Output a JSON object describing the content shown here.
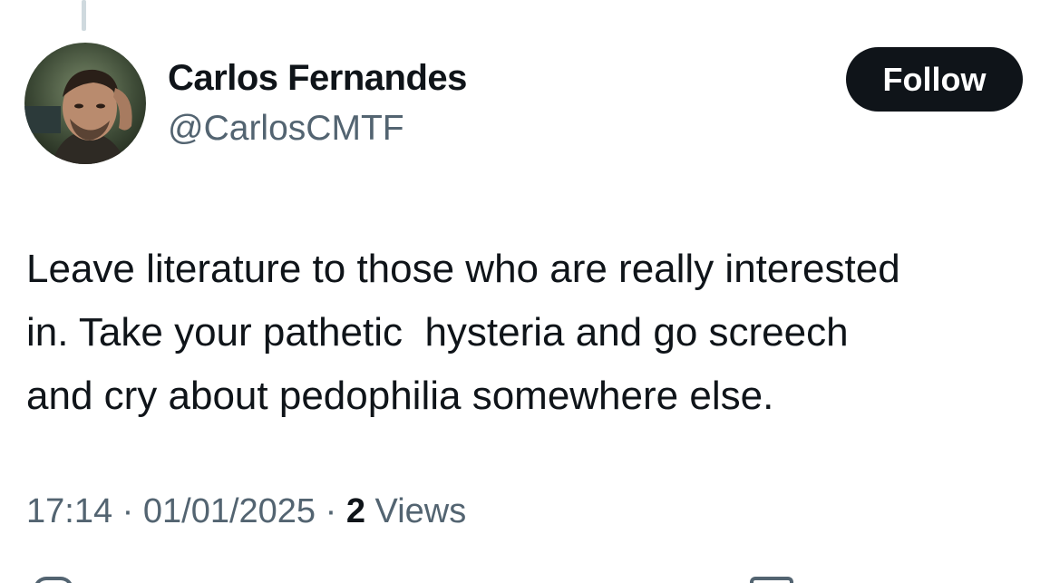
{
  "author": {
    "display_name": "Carlos Fernandes",
    "handle": "@CarlosCMTF"
  },
  "follow_button": {
    "label": "Follow"
  },
  "tweet": {
    "lines": [
      "Leave literature to those who are really interested",
      "in. Take your pathetic  hysteria and go screech",
      "and cry about pedophilia somewhere else."
    ]
  },
  "meta": {
    "time": "17:14",
    "separator": "·",
    "date": "01/01/2025",
    "views_count": "2",
    "views_label": "Views"
  },
  "colors": {
    "text_primary": "#0f1419",
    "text_secondary": "#536471",
    "button_bg": "#0f1419",
    "thread_line": "#cfd9de"
  },
  "icons": {
    "bottom_left": "reply-icon",
    "bottom_right": "bookmark-icon"
  }
}
